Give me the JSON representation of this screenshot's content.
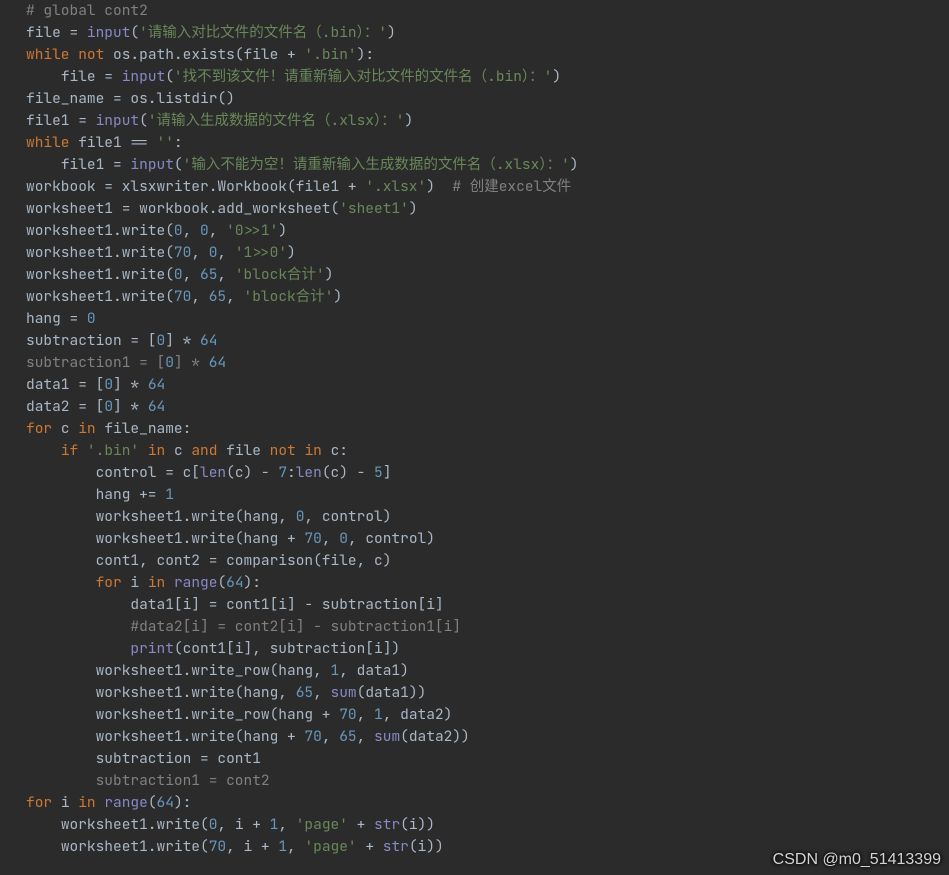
{
  "watermark": "CSDN @m0_51413399",
  "code": {
    "lines": [
      {
        "i": 0,
        "t": [
          [
            "cmt",
            "# global cont2"
          ]
        ]
      },
      {
        "i": 0,
        "t": [
          [
            "op",
            "file = "
          ],
          [
            "bi",
            "input"
          ],
          [
            "op",
            "("
          ],
          [
            "str",
            "'请输入对比文件的文件名（.bin）：'"
          ],
          [
            "op",
            ")"
          ]
        ]
      },
      {
        "i": 0,
        "t": [
          [
            "kw",
            "while "
          ],
          [
            "kw",
            "not "
          ],
          [
            "op",
            "os.path.exists(file + "
          ],
          [
            "str",
            "'.bin'"
          ],
          [
            "op",
            "):"
          ]
        ]
      },
      {
        "i": 1,
        "t": [
          [
            "op",
            "file = "
          ],
          [
            "bi",
            "input"
          ],
          [
            "op",
            "("
          ],
          [
            "str",
            "'找不到该文件！请重新输入对比文件的文件名（.bin）：'"
          ],
          [
            "op",
            ")"
          ]
        ]
      },
      {
        "i": 0,
        "t": [
          [
            "op",
            "file_name = os.listdir()"
          ]
        ]
      },
      {
        "i": 0,
        "t": [
          [
            "op",
            "file1 = "
          ],
          [
            "bi",
            "input"
          ],
          [
            "op",
            "("
          ],
          [
            "str",
            "'请输入生成数据的文件名（.xlsx）：'"
          ],
          [
            "op",
            ")"
          ]
        ]
      },
      {
        "i": 0,
        "t": [
          [
            "kw",
            "while "
          ],
          [
            "op",
            "file1 == "
          ],
          [
            "str",
            "''"
          ],
          [
            "op",
            ":"
          ]
        ]
      },
      {
        "i": 1,
        "t": [
          [
            "op",
            "file1 = "
          ],
          [
            "bi",
            "input"
          ],
          [
            "op",
            "("
          ],
          [
            "str",
            "'输入不能为空！请重新输入生成数据的文件名（.xlsx）：'"
          ],
          [
            "op",
            ")"
          ]
        ]
      },
      {
        "i": 0,
        "t": [
          [
            "op",
            "workbook = xlsxwriter.Workbook(file1 + "
          ],
          [
            "str",
            "'.xlsx'"
          ],
          [
            "op",
            ")  "
          ],
          [
            "cmt",
            "# 创建excel文件"
          ]
        ]
      },
      {
        "i": 0,
        "t": [
          [
            "op",
            "worksheet1 = workbook.add_worksheet("
          ],
          [
            "str",
            "'sheet1'"
          ],
          [
            "op",
            ")"
          ]
        ]
      },
      {
        "i": 0,
        "t": [
          [
            "op",
            "worksheet1.write("
          ],
          [
            "num",
            "0"
          ],
          [
            "op",
            ", "
          ],
          [
            "num",
            "0"
          ],
          [
            "op",
            ", "
          ],
          [
            "str",
            "'0>>1'"
          ],
          [
            "op",
            ")"
          ]
        ]
      },
      {
        "i": 0,
        "t": [
          [
            "op",
            "worksheet1.write("
          ],
          [
            "num",
            "70"
          ],
          [
            "op",
            ", "
          ],
          [
            "num",
            "0"
          ],
          [
            "op",
            ", "
          ],
          [
            "str",
            "'1>>0'"
          ],
          [
            "op",
            ")"
          ]
        ]
      },
      {
        "i": 0,
        "t": [
          [
            "op",
            "worksheet1.write("
          ],
          [
            "num",
            "0"
          ],
          [
            "op",
            ", "
          ],
          [
            "num",
            "65"
          ],
          [
            "op",
            ", "
          ],
          [
            "str",
            "'block合计'"
          ],
          [
            "op",
            ")"
          ]
        ]
      },
      {
        "i": 0,
        "t": [
          [
            "op",
            "worksheet1.write("
          ],
          [
            "num",
            "70"
          ],
          [
            "op",
            ", "
          ],
          [
            "num",
            "65"
          ],
          [
            "op",
            ", "
          ],
          [
            "str",
            "'block合计'"
          ],
          [
            "op",
            ")"
          ]
        ]
      },
      {
        "i": 0,
        "t": [
          [
            "op",
            "hang = "
          ],
          [
            "num",
            "0"
          ]
        ]
      },
      {
        "i": 0,
        "t": [
          [
            "op",
            "subtraction = ["
          ],
          [
            "num",
            "0"
          ],
          [
            "op",
            "] * "
          ],
          [
            "num",
            "64"
          ]
        ]
      },
      {
        "i": 0,
        "t": [
          [
            "cmt",
            "subtraction1 = ["
          ],
          [
            "num",
            "0"
          ],
          [
            "cmt",
            "] * "
          ],
          [
            "num",
            "64"
          ]
        ]
      },
      {
        "i": 0,
        "t": [
          [
            "op",
            "data1 = ["
          ],
          [
            "num",
            "0"
          ],
          [
            "op",
            "] * "
          ],
          [
            "num",
            "64"
          ]
        ]
      },
      {
        "i": 0,
        "t": [
          [
            "op",
            "data2 = ["
          ],
          [
            "num",
            "0"
          ],
          [
            "op",
            "] * "
          ],
          [
            "num",
            "64"
          ]
        ]
      },
      {
        "i": 0,
        "t": [
          [
            "kw",
            "for "
          ],
          [
            "op",
            "c "
          ],
          [
            "kw",
            "in "
          ],
          [
            "op",
            "file_name:"
          ]
        ]
      },
      {
        "i": 1,
        "t": [
          [
            "kw",
            "if "
          ],
          [
            "str",
            "'.bin'"
          ],
          [
            "kw",
            " in "
          ],
          [
            "op",
            "c "
          ],
          [
            "kw",
            "and "
          ],
          [
            "op",
            "file "
          ],
          [
            "kw",
            "not in "
          ],
          [
            "op",
            "c:"
          ]
        ]
      },
      {
        "i": 2,
        "t": [
          [
            "op",
            "control = c["
          ],
          [
            "bi",
            "len"
          ],
          [
            "op",
            "(c) - "
          ],
          [
            "num",
            "7"
          ],
          [
            "op",
            ":"
          ],
          [
            "bi",
            "len"
          ],
          [
            "op",
            "(c) - "
          ],
          [
            "num",
            "5"
          ],
          [
            "op",
            "]"
          ]
        ]
      },
      {
        "i": 2,
        "t": [
          [
            "op",
            "hang += "
          ],
          [
            "num",
            "1"
          ]
        ]
      },
      {
        "i": 2,
        "t": [
          [
            "op",
            "worksheet1.write(hang, "
          ],
          [
            "num",
            "0"
          ],
          [
            "op",
            ", control)"
          ]
        ]
      },
      {
        "i": 2,
        "t": [
          [
            "op",
            "worksheet1.write(hang + "
          ],
          [
            "num",
            "70"
          ],
          [
            "op",
            ", "
          ],
          [
            "num",
            "0"
          ],
          [
            "op",
            ", control)"
          ]
        ]
      },
      {
        "i": 2,
        "t": [
          [
            "op",
            "cont1, cont2 = comparison(file, c)"
          ]
        ]
      },
      {
        "i": 2,
        "t": [
          [
            "kw",
            "for "
          ],
          [
            "op",
            "i "
          ],
          [
            "kw",
            "in "
          ],
          [
            "bi",
            "range"
          ],
          [
            "op",
            "("
          ],
          [
            "num",
            "64"
          ],
          [
            "op",
            "):"
          ]
        ]
      },
      {
        "i": 3,
        "t": [
          [
            "op",
            "data1[i] = cont1[i] - subtraction[i]"
          ]
        ]
      },
      {
        "i": 3,
        "t": [
          [
            "cmt",
            "#data2[i] = cont2[i] - subtraction1[i]"
          ]
        ]
      },
      {
        "i": 3,
        "t": [
          [
            "bi",
            "print"
          ],
          [
            "op",
            "(cont1[i], subtraction[i])"
          ]
        ]
      },
      {
        "i": 2,
        "t": [
          [
            "op",
            "worksheet1.write_row(hang, "
          ],
          [
            "num",
            "1"
          ],
          [
            "op",
            ", data1)"
          ]
        ]
      },
      {
        "i": 2,
        "t": [
          [
            "op",
            "worksheet1.write(hang, "
          ],
          [
            "num",
            "65"
          ],
          [
            "op",
            ", "
          ],
          [
            "bi",
            "sum"
          ],
          [
            "op",
            "(data1))"
          ]
        ]
      },
      {
        "i": 2,
        "t": [
          [
            "op",
            "worksheet1.write_row(hang + "
          ],
          [
            "num",
            "70"
          ],
          [
            "op",
            ", "
          ],
          [
            "num",
            "1"
          ],
          [
            "op",
            ", data2)"
          ]
        ]
      },
      {
        "i": 2,
        "t": [
          [
            "op",
            "worksheet1.write(hang + "
          ],
          [
            "num",
            "70"
          ],
          [
            "op",
            ", "
          ],
          [
            "num",
            "65"
          ],
          [
            "op",
            ", "
          ],
          [
            "bi",
            "sum"
          ],
          [
            "op",
            "(data2))"
          ]
        ]
      },
      {
        "i": 2,
        "t": [
          [
            "op",
            "subtraction = cont1"
          ]
        ]
      },
      {
        "i": 2,
        "t": [
          [
            "cmt",
            "subtraction1 = cont2"
          ]
        ]
      },
      {
        "i": 0,
        "t": [
          [
            "kw",
            "for "
          ],
          [
            "op",
            "i "
          ],
          [
            "kw",
            "in "
          ],
          [
            "bi",
            "range"
          ],
          [
            "op",
            "("
          ],
          [
            "num",
            "64"
          ],
          [
            "op",
            "):"
          ]
        ]
      },
      {
        "i": 1,
        "t": [
          [
            "op",
            "worksheet1.write("
          ],
          [
            "num",
            "0"
          ],
          [
            "op",
            ", i + "
          ],
          [
            "num",
            "1"
          ],
          [
            "op",
            ", "
          ],
          [
            "str",
            "'page'"
          ],
          [
            "op",
            " + "
          ],
          [
            "bi",
            "str"
          ],
          [
            "op",
            "(i))"
          ]
        ]
      },
      {
        "i": 1,
        "t": [
          [
            "op",
            "worksheet1.write("
          ],
          [
            "num",
            "70"
          ],
          [
            "op",
            ", i + "
          ],
          [
            "num",
            "1"
          ],
          [
            "op",
            ", "
          ],
          [
            "str",
            "'page'"
          ],
          [
            "op",
            " + "
          ],
          [
            "bi",
            "str"
          ],
          [
            "op",
            "(i))"
          ]
        ]
      }
    ]
  }
}
